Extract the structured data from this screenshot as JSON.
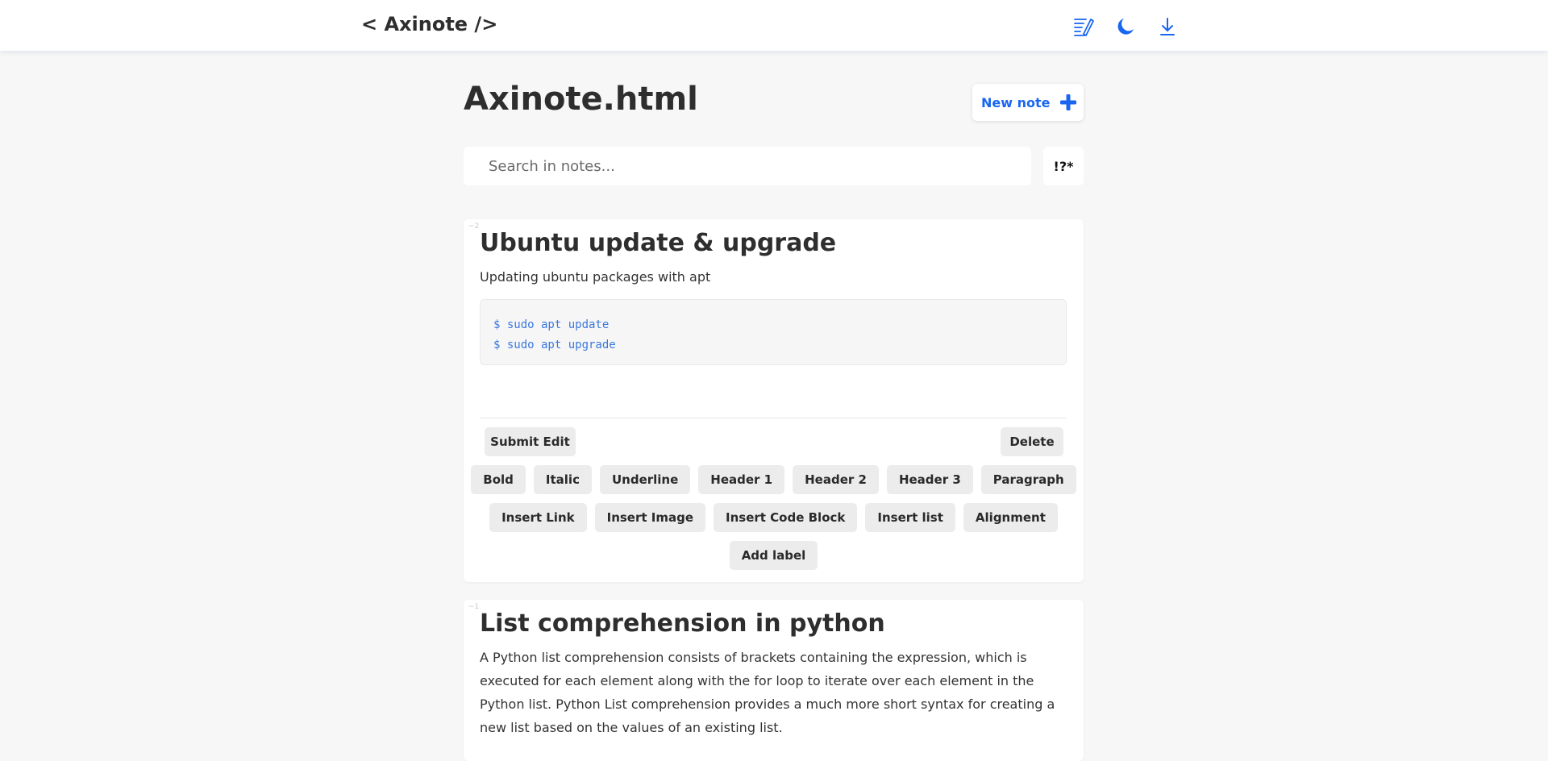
{
  "header": {
    "logo": "< Axinote />",
    "icons": [
      "notes-edit-icon",
      "moon-icon",
      "download-icon"
    ],
    "accent_color": "#1a66f0"
  },
  "page": {
    "title": "Axinote.html",
    "new_note_label": "New note",
    "search_placeholder": "Search in notes...",
    "regex_toggle_label": "!?*"
  },
  "notes": [
    {
      "id": "−2",
      "title": "Ubuntu update & upgrade",
      "description": "Updating ubuntu packages with apt",
      "code": [
        "$ sudo apt update",
        "$ sudo apt upgrade"
      ],
      "actions": {
        "submit_label": "Submit Edit",
        "delete_label": "Delete"
      },
      "toolbar_rows": [
        [
          "Bold",
          "Italic",
          "Underline",
          "Header 1",
          "Header 2",
          "Header 3",
          "Paragraph"
        ],
        [
          "Insert Link",
          "Insert Image",
          "Insert Code Block",
          "Insert list",
          "Alignment"
        ],
        [
          "Add label"
        ]
      ]
    },
    {
      "id": "−1",
      "title": "List comprehension in python",
      "description": "A Python list comprehension consists of brackets containing the expression, which is executed for each element along with the for loop to iterate over each element in the Python list. Python List comprehension provides a much more short syntax for creating a new list based on the values of an existing list."
    }
  ]
}
